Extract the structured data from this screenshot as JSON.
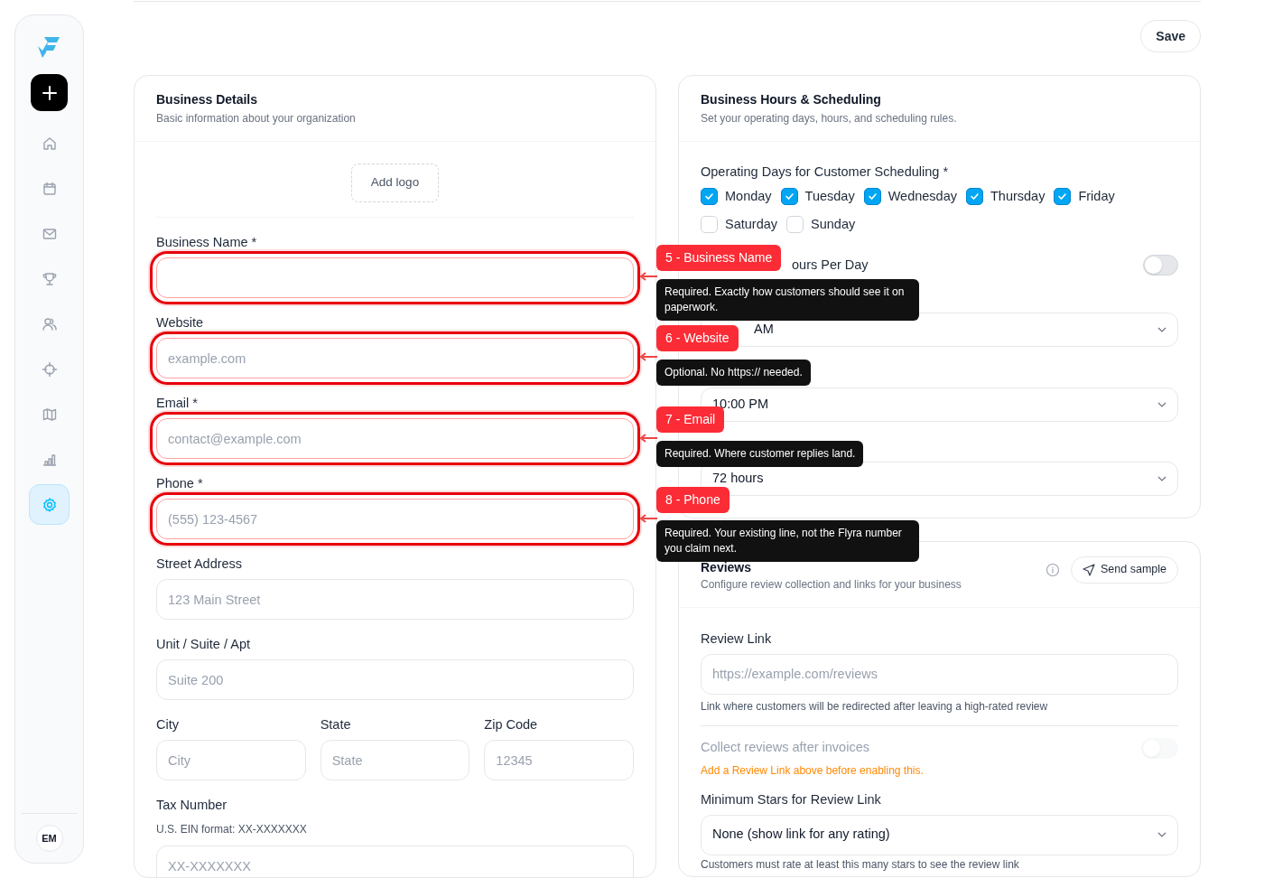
{
  "header": {
    "save_button": "Save"
  },
  "sidebar": {
    "items": [
      {
        "kind": "home",
        "selected": false
      },
      {
        "kind": "calendar",
        "selected": false
      },
      {
        "kind": "mail",
        "selected": false
      },
      {
        "kind": "trophy",
        "selected": false
      },
      {
        "kind": "users",
        "selected": false
      },
      {
        "kind": "target",
        "selected": false
      },
      {
        "kind": "map",
        "selected": false
      },
      {
        "kind": "chart",
        "selected": false
      },
      {
        "kind": "settings",
        "selected": true
      }
    ],
    "avatar": "EM"
  },
  "business_details": {
    "title": "Business Details",
    "subtitle": "Basic information about your organization",
    "add_logo": "Add logo",
    "fields": [
      {
        "label": "Business Name *",
        "highlighted": true
      },
      {
        "label": "Website",
        "placeholder": "example.com",
        "highlighted": true
      },
      {
        "label": "Email *",
        "placeholder": "contact@example.com",
        "highlighted": true
      },
      {
        "label": "Phone *",
        "placeholder": "(555) 123-4567",
        "highlighted": true
      },
      {
        "label": "Street Address",
        "placeholder": "123 Main Street",
        "highlighted": false
      },
      {
        "label": "Unit / Suite / Apt",
        "placeholder": "Suite 200",
        "highlighted": false
      }
    ],
    "address_row": [
      {
        "label": "City",
        "placeholder": "City"
      },
      {
        "label": "State",
        "placeholder": "State"
      },
      {
        "label": "Zip Code",
        "placeholder": "12345"
      }
    ],
    "tax": {
      "label": "Tax Number",
      "hint": "U.S. EIN format: XX-XXXXXXX",
      "placeholder": "XX-XXXXXXX"
    }
  },
  "scheduling": {
    "title": "Business Hours & Scheduling",
    "subtitle": "Set your operating days, hours, and scheduling rules.",
    "days_label": "Operating Days for Customer Scheduling *",
    "days": [
      {
        "label": "Monday",
        "checked": true
      },
      {
        "label": "Tuesday",
        "checked": true
      },
      {
        "label": "Wednesday",
        "checked": true
      },
      {
        "label": "Thursday",
        "checked": true
      },
      {
        "label": "Friday",
        "checked": true
      },
      {
        "label": "Saturday",
        "checked": false
      },
      {
        "label": "Sunday",
        "checked": false
      }
    ],
    "toggle": {
      "label": "ours Per Day",
      "on": false
    },
    "selects": [
      {
        "value": "AM"
      },
      {
        "value": "10:00 PM"
      },
      {
        "value": "72 hours"
      }
    ]
  },
  "reviews": {
    "title": "Reviews",
    "subtitle": "Configure review collection and links for your business",
    "send_sample": "Send sample",
    "review_link": {
      "label": "Review Link",
      "placeholder": "https://example.com/reviews",
      "hint": "Link where customers will be redirected after leaving a high-rated review"
    },
    "collect": {
      "label": "Collect reviews after invoices",
      "on": false,
      "disabled": true,
      "warning": "Add a Review Link above before enabling this."
    },
    "min_stars": {
      "label": "Minimum Stars for Review Link",
      "value": "None (show link for any rating)",
      "hint": "Customers must rate at least this many stars to see the review link"
    }
  },
  "annotations": [
    {
      "badge": "5 - Business Name",
      "tooltip": "Required. Exactly how customers should see it on paperwork."
    },
    {
      "badge": "6 - Website",
      "tooltip": "Optional. No https:// needed."
    },
    {
      "badge": "7 - Email",
      "tooltip": "Required. Where customer replies land."
    },
    {
      "badge": "8 - Phone",
      "tooltip": "Required. Your existing line, not the Flyra number you claim next."
    }
  ]
}
